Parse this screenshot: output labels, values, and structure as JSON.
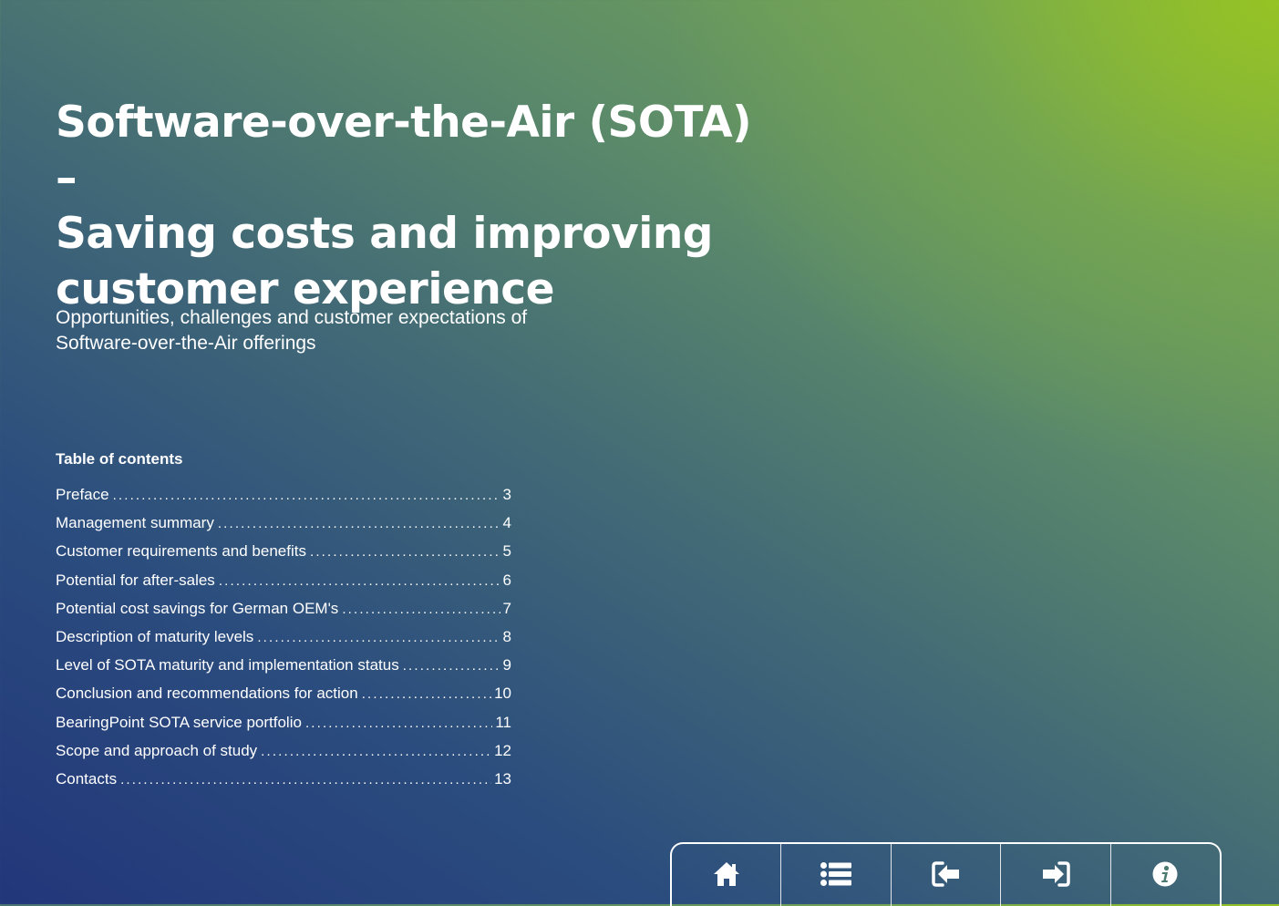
{
  "title": {
    "line1": "Software-over-the-Air (SOTA) –",
    "line2": "Saving costs and improving",
    "line3": "customer experience"
  },
  "subtitle": {
    "line1": "Opportunities, challenges and customer expectations of",
    "line2": "Software-over-the-Air offerings"
  },
  "toc": {
    "heading": "Table of contents",
    "items": [
      {
        "label": "Preface",
        "page": "3"
      },
      {
        "label": "Management summary",
        "page": "4"
      },
      {
        "label": "Customer requirements and benefits",
        "page": "5"
      },
      {
        "label": "Potential for after-sales",
        "page": "6"
      },
      {
        "label": "Potential cost savings for German OEM's",
        "page": "7"
      },
      {
        "label": "Description of maturity levels",
        "page": "8"
      },
      {
        "label": "Level of SOTA maturity and implementation status",
        "page": "9"
      },
      {
        "label": "Conclusion and recommendations for action",
        "page": "10"
      },
      {
        "label": "BearingPoint SOTA service portfolio",
        "page": "11"
      },
      {
        "label": "Scope and approach of study",
        "page": "12"
      },
      {
        "label": "Contacts",
        "page": "13"
      }
    ]
  },
  "navbar": {
    "buttons": [
      {
        "icon": "home-icon"
      },
      {
        "icon": "list-icon"
      },
      {
        "icon": "previous-page-icon"
      },
      {
        "icon": "next-page-icon"
      },
      {
        "icon": "info-icon"
      }
    ]
  },
  "colors": {
    "text": "#ffffff",
    "gradient_bottom_left": "#22367a",
    "gradient_top_right": "#96c323"
  }
}
